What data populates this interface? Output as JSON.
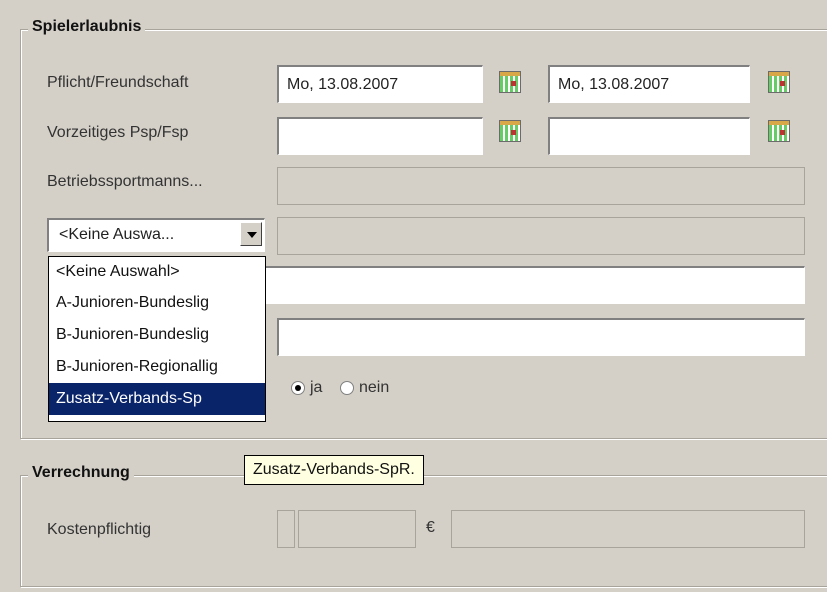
{
  "spielerlaubnis": {
    "title": "Spielerlaubnis",
    "row1": {
      "label": "Pflicht/Freundschaft",
      "date_from": "Mo, 13.08.2007",
      "date_to": "Mo, 13.08.2007"
    },
    "row2": {
      "label": "Vorzeitiges Psp/Fsp",
      "date_from": "",
      "date_to": ""
    },
    "row3": {
      "label": "Betriebssportmanns..."
    },
    "combo": {
      "selected": "<Keine Auswa...",
      "options": [
        "<Keine Auswahl>",
        "A-Junioren-Bundeslig",
        "B-Junioren-Bundeslig",
        "B-Junioren-Regionallig",
        "Zusatz-Verbands-Sp"
      ],
      "highlighted_index": 4
    },
    "radio": {
      "ja_label": "ja",
      "nein_label": "nein",
      "value": "ja"
    }
  },
  "verrechnung": {
    "title": "Verrechnung",
    "label": "Kostenpflichtig",
    "currency_symbol": "€"
  },
  "tooltip": {
    "text": "Zusatz-Verbands-SpR."
  },
  "icons": {
    "calendar": "calendar-icon",
    "dropdown": "chevron-down-icon"
  },
  "colors": {
    "selection": "#0a246a",
    "tooltip_bg": "#ffffe1",
    "window_bg": "#d4d0c8"
  }
}
